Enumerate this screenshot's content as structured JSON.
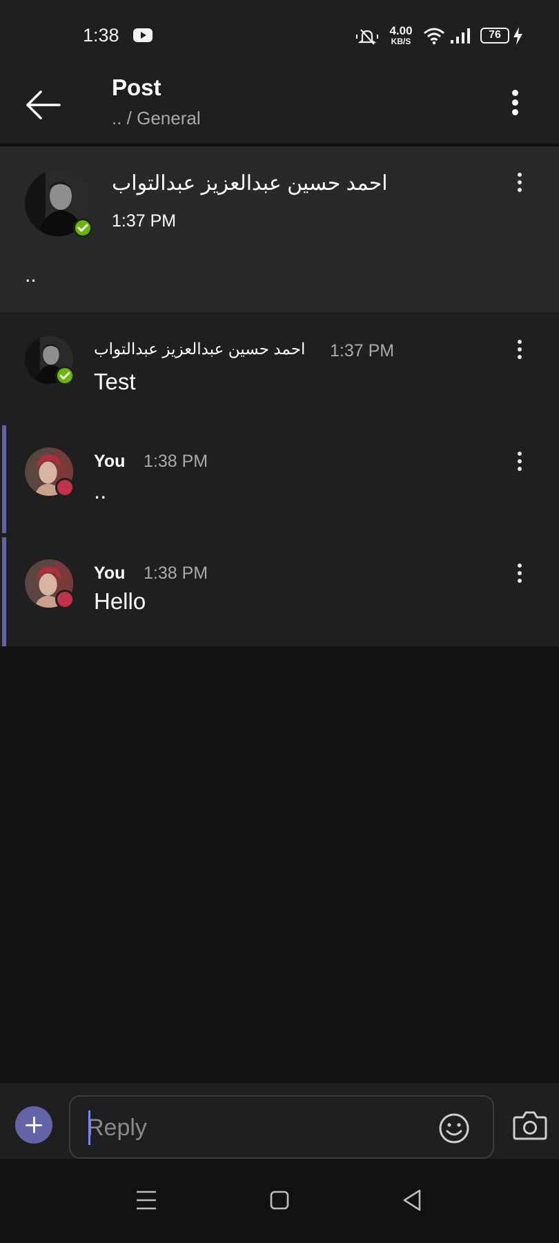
{
  "status_bar": {
    "time": "1:38",
    "network_speed_value": "4.00",
    "network_speed_unit": "KB/S",
    "battery_level": "76",
    "icons": [
      "youtube-icon",
      "mute-icon",
      "wifi-icon",
      "signal-icon",
      "battery-icon",
      "charging-icon"
    ]
  },
  "header": {
    "title": "Post",
    "breadcrumb": ".. / General"
  },
  "post": {
    "author": "احمد حسين عبدالعزيز عبدالتواب",
    "time": "1:37 PM",
    "body": "..",
    "presence": "available"
  },
  "replies": [
    {
      "author": "احمد حسين عبدالعزيز عبدالتواب",
      "time": "1:37 PM",
      "body": "Test",
      "presence": "available",
      "mine": false
    },
    {
      "author": "You",
      "time": "1:38 PM",
      "body": "..",
      "presence": "busy",
      "mine": true
    },
    {
      "author": "You",
      "time": "1:38 PM",
      "body": "Hello",
      "presence": "busy",
      "mine": true
    }
  ],
  "composer": {
    "placeholder": "Reply"
  },
  "colors": {
    "accent": "#6264a7",
    "available": "#6bb700",
    "busy": "#c4314b",
    "background": "#121212",
    "surface": "#1f1f1f"
  }
}
